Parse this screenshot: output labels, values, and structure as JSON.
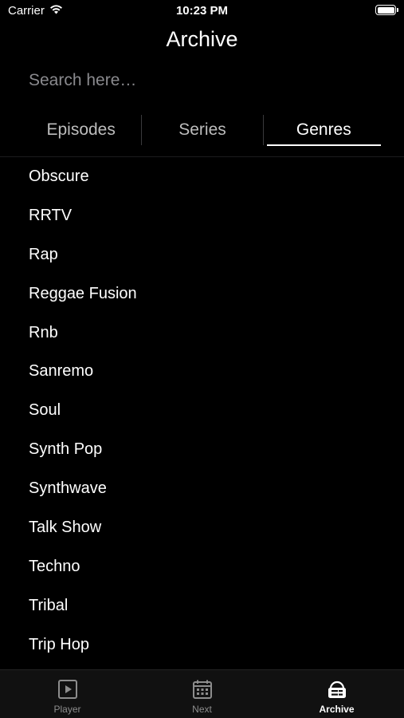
{
  "status_bar": {
    "carrier": "Carrier",
    "time": "10:23 PM"
  },
  "nav": {
    "title": "Archive"
  },
  "search": {
    "placeholder": "Search here…",
    "value": ""
  },
  "segments": {
    "items": [
      "Episodes",
      "Series",
      "Genres"
    ],
    "selected": "Genres"
  },
  "genres": [
    "Obscure",
    "RRTV",
    "Rap",
    "Reggae Fusion",
    "Rnb",
    "Sanremo",
    "Soul",
    "Synth Pop",
    "Synthwave",
    "Talk Show",
    "Techno",
    "Tribal",
    "Trip Hop"
  ],
  "tab_bar": {
    "tabs": [
      {
        "label": "Player",
        "icon": "play-square-icon"
      },
      {
        "label": "Next",
        "icon": "calendar-icon"
      },
      {
        "label": "Archive",
        "icon": "archive-radio-icon"
      }
    ],
    "active": "Archive"
  },
  "colors": {
    "background": "#000000",
    "text": "#ffffff",
    "placeholder": "#8a8a8e",
    "inactive_tab": "#8d8d8d"
  }
}
